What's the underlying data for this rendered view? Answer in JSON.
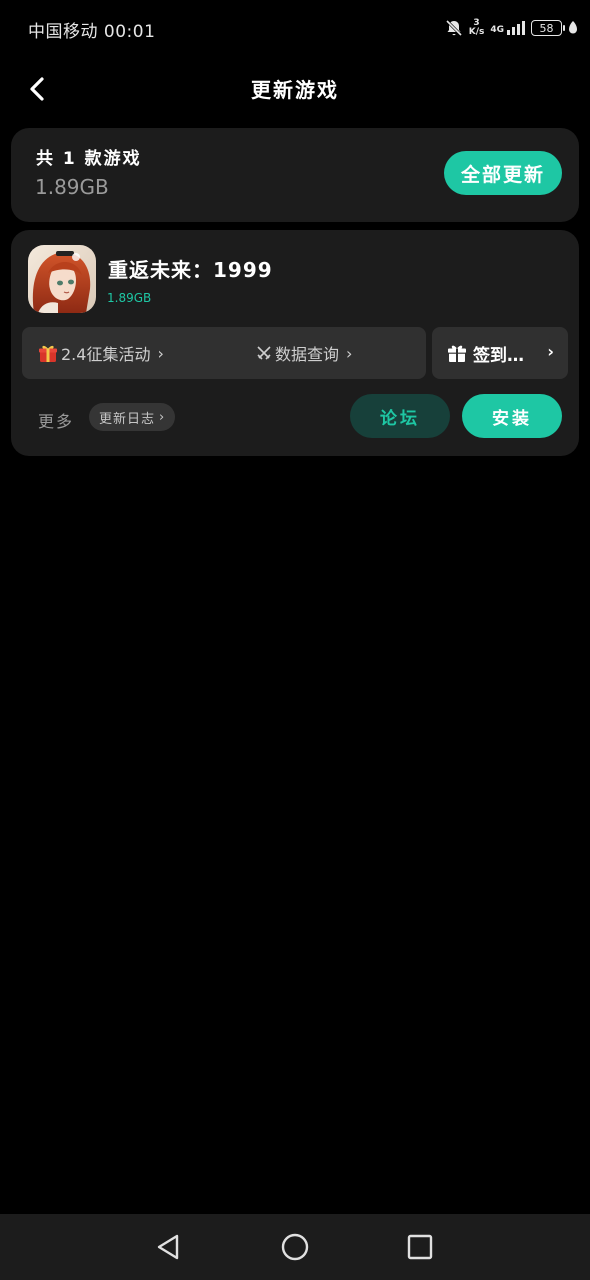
{
  "status_bar": {
    "carrier_time": "中国移动 00:01",
    "speed_value": "3",
    "speed_unit": "K/s",
    "network": "4G",
    "battery": "58"
  },
  "header": {
    "back_icon": "chevron-left-icon",
    "title": "更新游戏"
  },
  "summary": {
    "count_text": "共 1 款游戏",
    "total_size": "1.89GB",
    "update_all_label": "全部更新"
  },
  "game": {
    "name": "重返未来：1999",
    "size": "1.89GB",
    "promos": [
      {
        "icon": "gift-box-icon",
        "label": "2.4征集活动"
      },
      {
        "icon": "crossed-swords-icon",
        "label": "数据查询"
      }
    ],
    "checkin_label": "签到…",
    "more_label": "更多",
    "changelog_label": "更新日志",
    "forum_label": "论坛",
    "install_label": "安装"
  },
  "colors": {
    "accent": "#1ec7a4",
    "forum_bg": "#17403a",
    "card_bg": "#1c1c1c",
    "pill_bg": "#303030"
  }
}
